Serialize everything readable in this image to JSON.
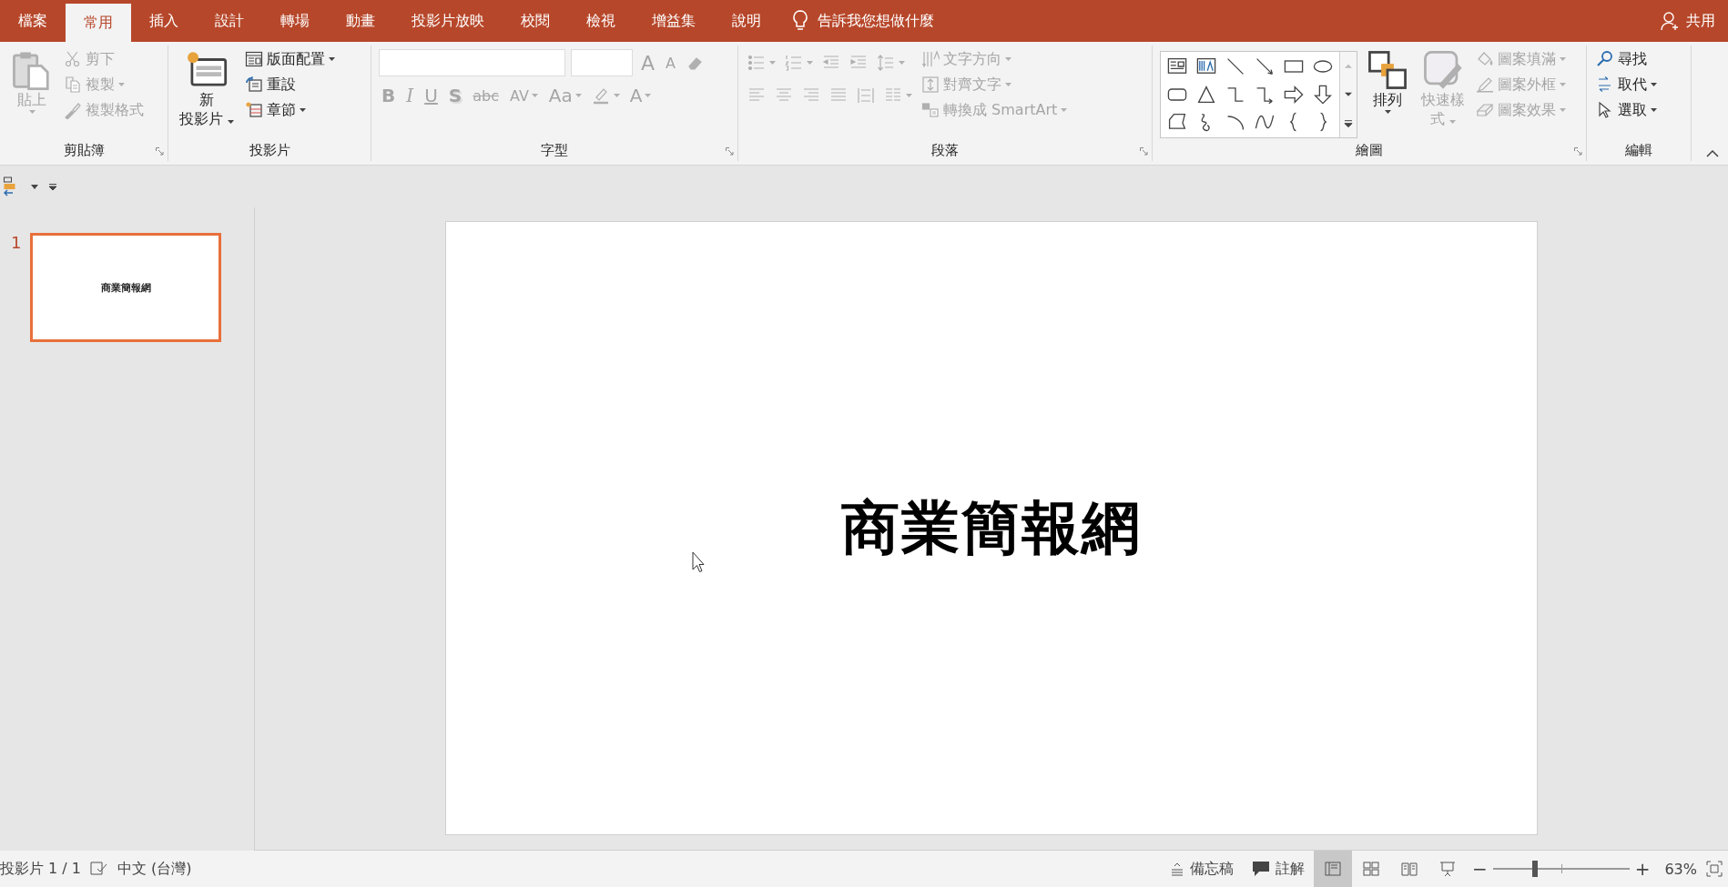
{
  "tabs": [
    {
      "label": "檔案",
      "selected": false
    },
    {
      "label": "常用",
      "selected": true
    },
    {
      "label": "插入",
      "selected": false
    },
    {
      "label": "設計",
      "selected": false
    },
    {
      "label": "轉場",
      "selected": false
    },
    {
      "label": "動畫",
      "selected": false
    },
    {
      "label": "投影片放映",
      "selected": false
    },
    {
      "label": "校閱",
      "selected": false
    },
    {
      "label": "檢視",
      "selected": false
    },
    {
      "label": "增益集",
      "selected": false
    },
    {
      "label": "說明",
      "selected": false
    }
  ],
  "tell_me": "告訴我您想做什麼",
  "share": "共用",
  "ribbon": {
    "groups": [
      {
        "kind": "clipboard",
        "label": "剪貼簿",
        "launcher": true,
        "large": [
          {
            "kind": "paste",
            "lines": [
              "貼上"
            ],
            "disabled": true,
            "dropdown": true
          }
        ],
        "small": [
          {
            "kind": "cut",
            "text": "剪下",
            "disabled": true,
            "dropdown": false
          },
          {
            "kind": "copy",
            "text": "複製",
            "disabled": true,
            "dropdown": true
          },
          {
            "kind": "painter",
            "text": "複製格式",
            "disabled": true,
            "dropdown": false
          }
        ]
      },
      {
        "kind": "slides",
        "label": "投影片",
        "launcher": false,
        "large": [
          {
            "kind": "newslide",
            "lines": [
              "新",
              "投影片"
            ],
            "disabled": false,
            "dropdown": true
          }
        ],
        "small": [
          {
            "kind": "layout",
            "text": "版面配置",
            "disabled": false,
            "dropdown": true
          },
          {
            "kind": "reset",
            "text": "重設",
            "disabled": false,
            "dropdown": false
          },
          {
            "kind": "section",
            "text": "章節",
            "disabled": false,
            "dropdown": true
          }
        ]
      },
      {
        "kind": "font",
        "label": "字型",
        "launcher": true,
        "font_box": {
          "disabled": true
        },
        "size_box": {
          "disabled": true
        },
        "row_1": [
          {
            "kind": "grow",
            "text": "A",
            "disabled": true,
            "dropdown": false
          },
          {
            "kind": "shrink",
            "text": "A",
            "disabled": true,
            "dropdown": false
          },
          {
            "kind": "clear",
            "disabled": true,
            "dropdown": false
          }
        ],
        "row_2": [
          {
            "kind": "bold",
            "text": "B",
            "disabled": true,
            "dropdown": false
          },
          {
            "kind": "italic",
            "text": "I",
            "disabled": true,
            "dropdown": false
          },
          {
            "kind": "underline",
            "text": "U",
            "disabled": true,
            "dropdown": false
          },
          {
            "kind": "shadow",
            "text": "S",
            "disabled": true,
            "dropdown": false
          },
          {
            "kind": "strike",
            "text": "abc",
            "disabled": true,
            "dropdown": false
          },
          {
            "kind": "spacing",
            "text": "AV",
            "disabled": true,
            "dropdown": true
          },
          {
            "kind": "case",
            "text": "Aa",
            "disabled": true,
            "dropdown": true
          },
          {
            "kind": "highlight",
            "disabled": true,
            "dropdown": true
          },
          {
            "kind": "fontcolor",
            "text": "A",
            "disabled": true,
            "dropdown": true
          }
        ]
      },
      {
        "kind": "paragraph",
        "label": "段落",
        "launcher": true,
        "row_1": [
          {
            "kind": "bullets",
            "disabled": true,
            "dropdown": true
          },
          {
            "kind": "numbering",
            "disabled": true,
            "dropdown": true
          },
          {
            "kind": "outdent",
            "disabled": true,
            "dropdown": false
          },
          {
            "kind": "indent",
            "disabled": true,
            "dropdown": false
          },
          {
            "kind": "linespacing",
            "disabled": true,
            "dropdown": true
          }
        ],
        "row_2": [
          {
            "kind": "alignleft",
            "disabled": true,
            "dropdown": false
          },
          {
            "kind": "center",
            "disabled": true,
            "dropdown": false
          },
          {
            "kind": "alignright",
            "disabled": true,
            "dropdown": false
          },
          {
            "kind": "justify",
            "disabled": true,
            "dropdown": false
          },
          {
            "kind": "distribute",
            "disabled": true,
            "dropdown": false
          },
          {
            "kind": "columns",
            "disabled": true,
            "dropdown": true
          }
        ],
        "small": [
          {
            "kind": "direction",
            "text": "文字方向",
            "disabled": true,
            "dropdown": true
          },
          {
            "kind": "aligntext",
            "text": "對齊文字",
            "disabled": true,
            "dropdown": true
          },
          {
            "kind": "smartart",
            "text": "轉換成 SmartArt",
            "disabled": true,
            "dropdown": true
          }
        ]
      },
      {
        "kind": "drawing",
        "label": "繪圖",
        "launcher": true,
        "large": [
          {
            "kind": "arrange",
            "lines": [
              "排列"
            ],
            "disabled": false,
            "dropdown": true
          },
          {
            "kind": "styles",
            "lines": [
              "快速樣",
              "式"
            ],
            "disabled": true,
            "dropdown": true
          }
        ],
        "small": [
          {
            "kind": "fill",
            "text": "圖案填滿",
            "disabled": true,
            "dropdown": true
          },
          {
            "kind": "outline",
            "text": "圖案外框",
            "disabled": true,
            "dropdown": true
          },
          {
            "kind": "effects",
            "text": "圖案效果",
            "disabled": true,
            "dropdown": true
          }
        ]
      },
      {
        "kind": "editing",
        "label": "編輯",
        "launcher": false,
        "small": [
          {
            "kind": "find",
            "text": "尋找",
            "disabled": false,
            "dropdown": false
          },
          {
            "kind": "replace",
            "text": "取代",
            "disabled": false,
            "dropdown": true
          },
          {
            "kind": "select",
            "text": "選取",
            "disabled": false,
            "dropdown": true
          }
        ]
      }
    ]
  },
  "thumbnails": [
    {
      "number": "1",
      "title": "商業簡報網",
      "selected": true
    }
  ],
  "slide": {
    "title": "商業簡報網"
  },
  "status_bar": {
    "slide_counter": "投影片 1 / 1",
    "language": "中文 (台灣)",
    "notes": "備忘稿",
    "comments": "註解",
    "views": [
      {
        "kind": "normal",
        "selected": true
      },
      {
        "kind": "sorter",
        "selected": false
      },
      {
        "kind": "reading",
        "selected": false
      },
      {
        "kind": "slideshow",
        "selected": false
      }
    ],
    "zoom_out": "−",
    "zoom_in": "+",
    "zoom": {
      "level": 0.31
    },
    "zoom_reading": "63%"
  }
}
